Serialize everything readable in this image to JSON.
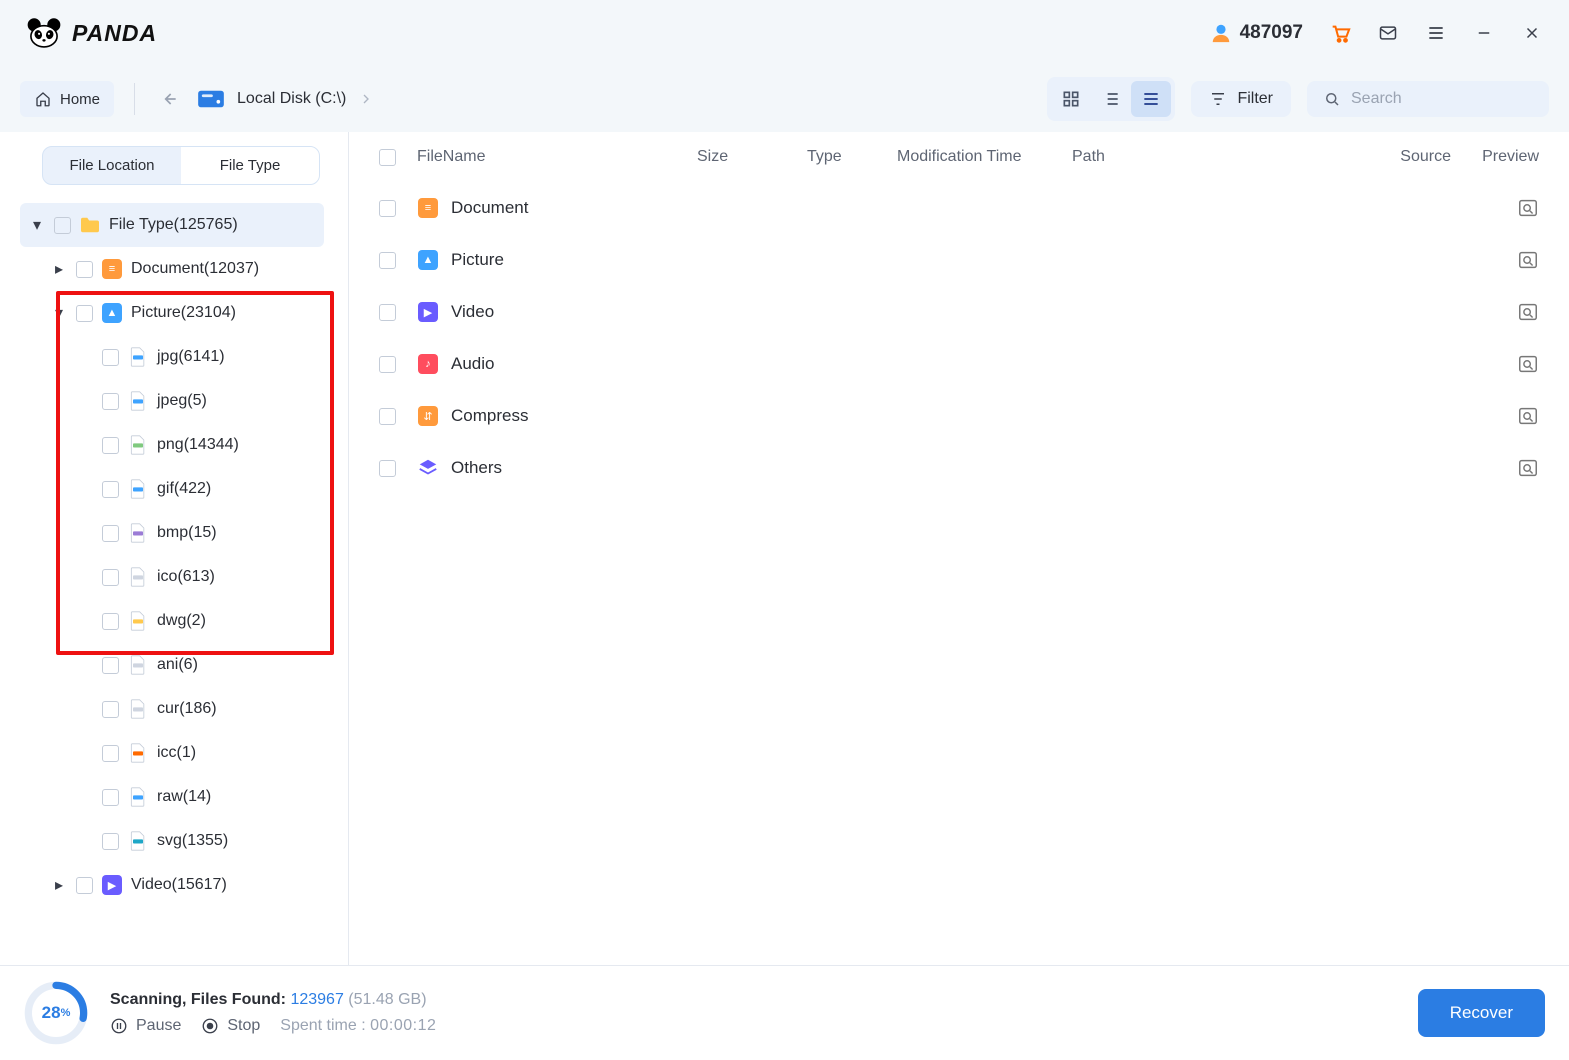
{
  "topbar": {
    "brand": "PANDA",
    "user_id": "487097"
  },
  "toolbar": {
    "home_label": "Home",
    "breadcrumb_label": "Local Disk (C:\\)",
    "filter_label": "Filter",
    "search_placeholder": "Search"
  },
  "sidebar": {
    "tabs": {
      "location": "File Location",
      "type": "File Type"
    },
    "root": "File Type(125765)",
    "document": "Document(12037)",
    "picture": "Picture(23104)",
    "picture_children": {
      "jpg": "jpg(6141)",
      "jpeg": "jpeg(5)",
      "png": "png(14344)",
      "gif": "gif(422)",
      "bmp": "bmp(15)",
      "ico": "ico(613)",
      "dwg": "dwg(2)",
      "ani": "ani(6)",
      "cur": "cur(186)",
      "icc": "icc(1)",
      "raw": "raw(14)",
      "svg": "svg(1355)"
    },
    "video": "Video(15617)"
  },
  "table": {
    "headers": {
      "name": "FileName",
      "size": "Size",
      "type": "Type",
      "mod": "Modification Time",
      "path": "Path",
      "source": "Source",
      "preview": "Preview"
    },
    "rows": [
      {
        "label": "Document",
        "color": "#ff9a3c"
      },
      {
        "label": "Picture",
        "color": "#3ea3ff"
      },
      {
        "label": "Video",
        "color": "#6a5cff"
      },
      {
        "label": "Audio",
        "color": "#ff4d5e"
      },
      {
        "label": "Compress",
        "color": "#ff9a3c"
      },
      {
        "label": "Others",
        "color": "#6a5cff"
      }
    ]
  },
  "footer": {
    "percent": "28",
    "percent_suffix": "%",
    "found_label": "Scanning, Files Found:",
    "count": "123967",
    "size": "(51.48 GB)",
    "pause": "Pause",
    "stop": "Stop",
    "spent_label": "Spent time :",
    "spent_time": "00:00:12",
    "recover": "Recover"
  }
}
